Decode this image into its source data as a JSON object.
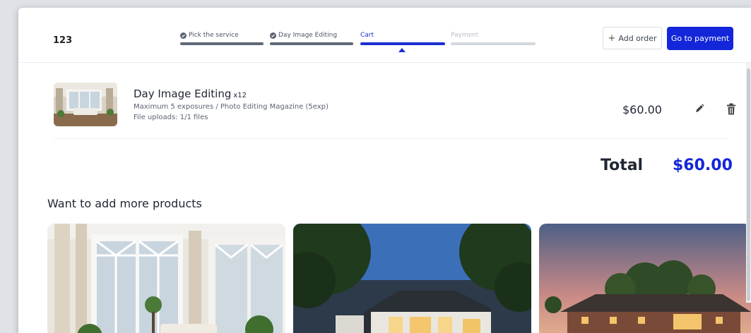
{
  "header": {
    "order_id": "123",
    "steps": [
      {
        "label": "Pick the service",
        "status": "done"
      },
      {
        "label": "Day Image Editing",
        "status": "done"
      },
      {
        "label": "Cart",
        "status": "active"
      },
      {
        "label": "Payment",
        "status": "todo"
      }
    ],
    "add_order_label": "Add order",
    "add_order_icon": "plus-icon",
    "go_to_payment_label": "Go to payment"
  },
  "cart": {
    "item": {
      "title": "Day Image Editing",
      "quantity": "x12",
      "description": "Maximum 5 exposures / Photo Editing Magazine (5exp)",
      "files": "File uploads: 1/1 files",
      "price": "$60.00",
      "edit_icon": "pencil-icon",
      "delete_icon": "trash-icon"
    },
    "total_label": "Total",
    "total_value": "$60.00"
  },
  "upsell": {
    "title": "Want to add more products",
    "products": [
      {
        "image": "interior-living-room-photo"
      },
      {
        "image": "modern-house-dusk-photo"
      },
      {
        "image": "ranch-house-sunset-photo"
      }
    ]
  },
  "colors": {
    "accent": "#1326d9",
    "step_done": "#5f6875",
    "step_todo": "#d4d8de"
  }
}
